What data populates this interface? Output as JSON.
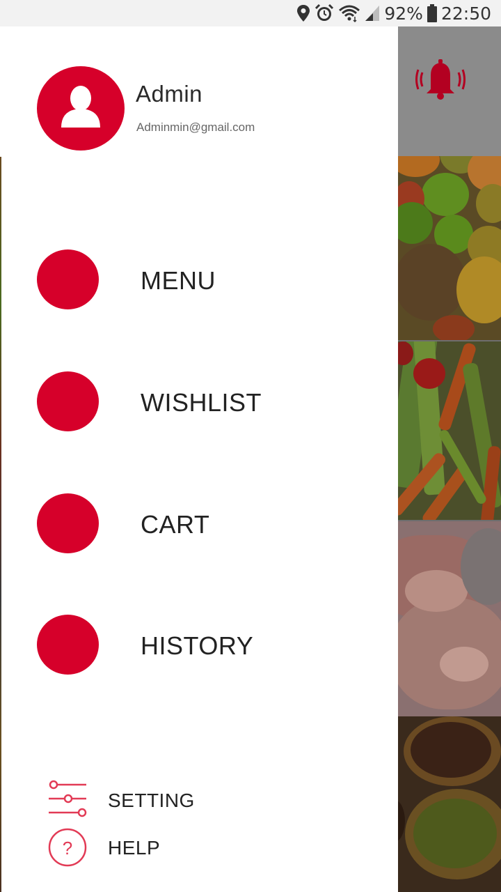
{
  "status_bar": {
    "battery_percent": "92%",
    "time": "22:50",
    "icons": [
      "location-icon",
      "alarm-icon",
      "wifi-icon",
      "signal-icon",
      "battery-icon"
    ]
  },
  "drawer": {
    "user": {
      "name": "Admin",
      "email": "Adminmin@gmail.com",
      "avatar_icon": "user-avatar-icon"
    },
    "nav_items": [
      {
        "label": "MENU"
      },
      {
        "label": "WISHLIST"
      },
      {
        "label": "CART"
      },
      {
        "label": "HISTORY"
      }
    ],
    "footer": {
      "setting_label": "SETTING",
      "setting_icon": "sliders-icon",
      "help_label": "HELP",
      "help_icon": "help-icon",
      "help_glyph": "?"
    }
  },
  "background": {
    "notification_icon": "bell-icon",
    "category_tiles": [
      "fruit-image",
      "vegetable-image",
      "meat-image",
      "spice-image"
    ]
  },
  "colors": {
    "accent": "#d6002a",
    "icon_accent": "#e23a55",
    "status_bar_bg": "#f2f2f2",
    "drawer_bg": "#ffffff"
  }
}
